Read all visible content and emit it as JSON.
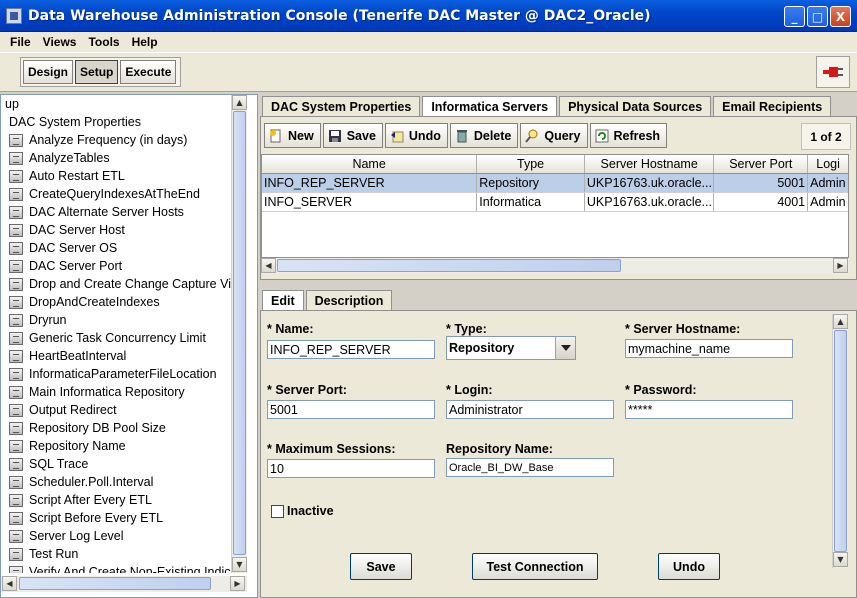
{
  "window": {
    "title": "Data Warehouse Administration Console (Tenerife DAC Master @ DAC2_Oracle)",
    "minimize": "_",
    "maximize": "□",
    "close": "X"
  },
  "menu": [
    "File",
    "Views",
    "Tools",
    "Help"
  ],
  "modes": [
    "Design",
    "Setup",
    "Execute"
  ],
  "active_mode": "Setup",
  "left_list": {
    "items": [
      {
        "label": "up",
        "icon": "none"
      },
      {
        "label": "DAC System Properties",
        "icon": "none"
      },
      {
        "label": "Analyze Frequency (in days)",
        "icon": "property-icon"
      },
      {
        "label": "AnalyzeTables",
        "icon": "property-icon"
      },
      {
        "label": "Auto Restart ETL",
        "icon": "property-icon"
      },
      {
        "label": "CreateQueryIndexesAtTheEnd",
        "icon": "property-icon"
      },
      {
        "label": "DAC Alternate Server Hosts",
        "icon": "property-icon"
      },
      {
        "label": "DAC Server Host",
        "icon": "property-icon"
      },
      {
        "label": "DAC Server OS",
        "icon": "property-icon"
      },
      {
        "label": "DAC Server Port",
        "icon": "property-icon"
      },
      {
        "label": "Drop and Create Change Capture Vie",
        "icon": "property-icon"
      },
      {
        "label": "DropAndCreateIndexes",
        "icon": "property-icon"
      },
      {
        "label": "Dryrun",
        "icon": "property-icon"
      },
      {
        "label": "Generic Task Concurrency Limit",
        "icon": "property-icon"
      },
      {
        "label": "HeartBeatInterval",
        "icon": "property-icon"
      },
      {
        "label": "InformaticaParameterFileLocation",
        "icon": "property-icon"
      },
      {
        "label": "Main Informatica Repository",
        "icon": "property-icon"
      },
      {
        "label": "Output Redirect",
        "icon": "property-icon"
      },
      {
        "label": "Repository DB Pool Size",
        "icon": "property-icon"
      },
      {
        "label": "Repository Name",
        "icon": "property-icon"
      },
      {
        "label": "SQL Trace",
        "icon": "property-icon"
      },
      {
        "label": "Scheduler.Poll.Interval",
        "icon": "property-icon"
      },
      {
        "label": "Script After Every ETL",
        "icon": "property-icon"
      },
      {
        "label": "Script Before Every ETL",
        "icon": "property-icon"
      },
      {
        "label": "Server Log Level",
        "icon": "property-icon"
      },
      {
        "label": "Test Run",
        "icon": "property-icon"
      },
      {
        "label": "Verify And Create Non-Existing Indic",
        "icon": "property-icon"
      }
    ]
  },
  "tabs": [
    "DAC System Properties",
    "Informatica Servers",
    "Physical Data Sources",
    "Email Recipients"
  ],
  "active_tab": "Informatica Servers",
  "actions": [
    {
      "label": "New",
      "icon": "new-icon"
    },
    {
      "label": "Save",
      "icon": "save-icon"
    },
    {
      "label": "Undo",
      "icon": "undo-icon"
    },
    {
      "label": "Delete",
      "icon": "delete-icon"
    },
    {
      "label": "Query",
      "icon": "query-icon"
    },
    {
      "label": "Refresh",
      "icon": "refresh-icon"
    }
  ],
  "page_count": "1 of 2",
  "grid": {
    "columns": [
      "Name",
      "Type",
      "Server Hostname",
      "Server Port",
      "Logi"
    ],
    "rows": [
      [
        "INFO_REP_SERVER",
        "Repository",
        "UKP16763.uk.oracle....",
        "5001",
        "Admin"
      ],
      [
        "INFO_SERVER",
        "Informatica",
        "UKP16763.uk.oracle....",
        "4001",
        "Admin"
      ]
    ],
    "selected_row": 0
  },
  "edit_tabs": [
    "Edit",
    "Description"
  ],
  "form": {
    "name_label": "* Name:",
    "name_value": "INFO_REP_SERVER",
    "type_label": "* Type:",
    "type_value": "Repository",
    "host_label": "* Server Hostname:",
    "host_value": "mymachine_name",
    "port_label": "* Server Port:",
    "port_value": "5001",
    "login_label": "* Login:",
    "login_value": "Administrator",
    "password_label": "* Password:",
    "password_value": "*****",
    "max_label": "* Maximum Sessions:",
    "max_value": "10",
    "repo_label": "Repository Name:",
    "repo_value": "Oracle_BI_DW_Base",
    "inactive_label": "Inactive",
    "inactive_checked": false,
    "buttons": [
      "Save",
      "Test Connection",
      "Undo"
    ]
  },
  "colors": {
    "titlebar": "#0146c8",
    "selection": "#bccfe8",
    "plug_red": "#d81818"
  }
}
